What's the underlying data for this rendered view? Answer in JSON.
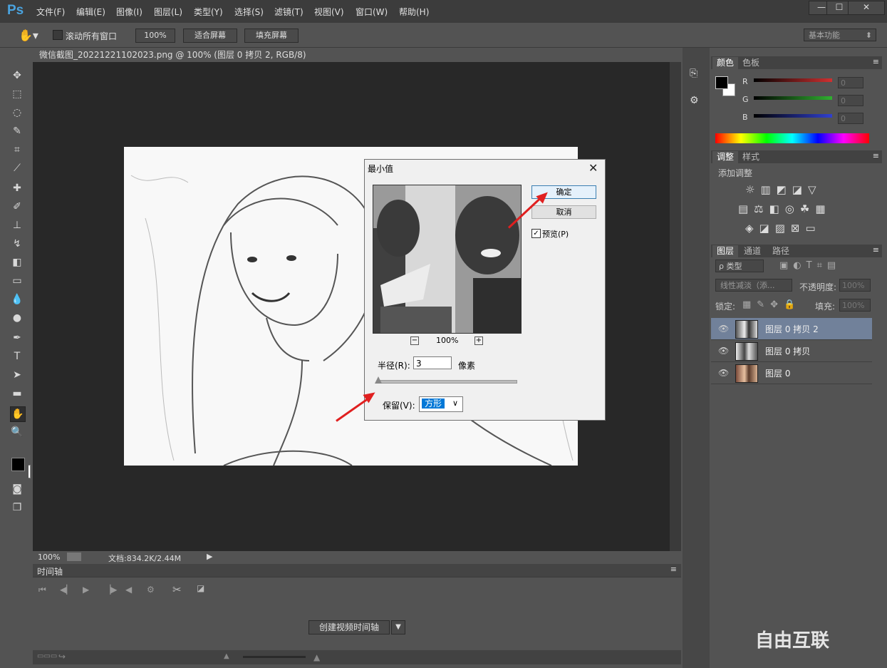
{
  "app": {
    "logo": "Ps",
    "menu": [
      "文件(F)",
      "编辑(E)",
      "图像(I)",
      "图层(L)",
      "类型(Y)",
      "选择(S)",
      "滤镜(T)",
      "视图(V)",
      "窗口(W)",
      "帮助(H)"
    ],
    "window_controls": [
      "—",
      "☐",
      "✕"
    ]
  },
  "options_bar": {
    "scroll_all_label": "滚动所有窗口",
    "scroll_all_checked": false,
    "zoom_100": "100%",
    "fit_screen": "适合屏幕",
    "fill_screen": "填充屏幕",
    "workspace": "基本功能"
  },
  "document": {
    "tab_title": "微信截图_20221221102023.png @ 100% (图层 0 拷贝 2, RGB/8) *",
    "tab_close": "×",
    "status_zoom": "100%",
    "status_doc": "文档:834.2K/2.44M"
  },
  "timeline": {
    "title": "时间轴",
    "create_button": "创建视频时间轴"
  },
  "color_panel": {
    "tabs": [
      "颜色",
      "色板"
    ],
    "channels": [
      {
        "label": "R",
        "value": "0",
        "color": "#d03030"
      },
      {
        "label": "G",
        "value": "0",
        "color": "#30b030"
      },
      {
        "label": "B",
        "value": "0",
        "color": "#3040d0"
      }
    ]
  },
  "adjust_panel": {
    "tabs": [
      "调整",
      "样式"
    ],
    "add_label": "添加调整"
  },
  "layers_panel": {
    "tabs": [
      "图层",
      "通道",
      "路径"
    ],
    "filter_kind": "ρ 类型",
    "blend_mode": "线性减淡（添...",
    "opacity_label": "不透明度:",
    "opacity_value": "100%",
    "lock_label": "锁定:",
    "fill_label": "填充:",
    "fill_value": "100%",
    "layers": [
      {
        "name": "图层 0 拷贝 2",
        "selected": true
      },
      {
        "name": "图层 0 拷贝",
        "selected": false
      },
      {
        "name": "图层 0",
        "selected": false
      }
    ]
  },
  "dialog": {
    "title": "最小值",
    "close": "✕",
    "ok": "确定",
    "cancel": "取消",
    "preview_label": "预览(P)",
    "preview_checked": true,
    "zoom_level": "100%",
    "zoom_out": "−",
    "zoom_in": "+",
    "radius_label": "半径(R):",
    "radius_value": "3",
    "radius_unit": "像素",
    "preserve_label": "保留(V):",
    "preserve_value": "方形"
  },
  "watermark": "自由互联"
}
